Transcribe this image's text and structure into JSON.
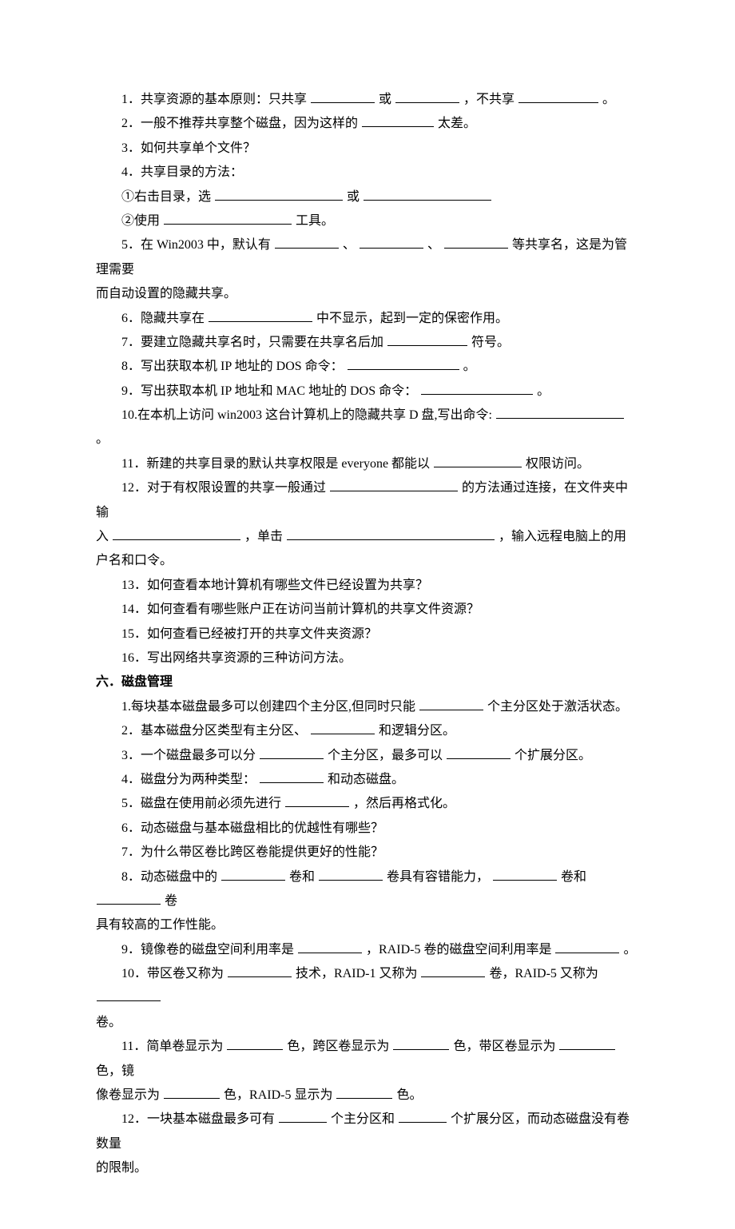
{
  "section5": {
    "q1": {
      "a": "1．共享资源的基本原则：只共享",
      "b": "或",
      "c": "，不共享",
      "d": "。"
    },
    "q2": {
      "a": "2．一般不推荐共享整个磁盘，因为这样的",
      "b": "太差。"
    },
    "q3": "3．如何共享单个文件？",
    "q4": "4．共享目录的方法：",
    "q4a": {
      "a": "①右击目录，选",
      "b": "或"
    },
    "q4b": {
      "a": "②使用",
      "b": "工具。"
    },
    "q5": {
      "a": "5．在 Win2003 中，默认有",
      "b": "、",
      "c": "、",
      "d": "等共享名，这是为管理需要"
    },
    "q5_cont": "而自动设置的隐藏共享。",
    "q6": {
      "a": "6．隐藏共享在",
      "b": "中不显示，起到一定的保密作用。"
    },
    "q7": {
      "a": "7．要建立隐藏共享名时，只需要在共享名后加",
      "b": "符号。"
    },
    "q8": {
      "a": "8．写出获取本机 IP 地址的 DOS 命令：",
      "b": "。"
    },
    "q9": {
      "a": "9．写出获取本机 IP 地址和 MAC 地址的 DOS 命令：",
      "b": "。"
    },
    "q10": {
      "a": "10.在本机上访问 win2003 这台计算机上的隐藏共享 D 盘,写出命令:",
      "b": "。"
    },
    "q11": {
      "a": "11．新建的共享目录的默认共享权限是 everyone 都能以",
      "b": "权限访问。"
    },
    "q12": {
      "a": "12．对于有权限设置的共享一般通过",
      "b": "的方法通过连接，在文件夹中输"
    },
    "q12_cont": {
      "a": "入",
      "b": "，单击",
      "c": "，输入远程电脑上的用"
    },
    "q12_cont2": "户名和口令。",
    "q13": "13．如何查看本地计算机有哪些文件已经设置为共享？",
    "q14": "14．如何查看有哪些账户正在访问当前计算机的共享文件资源？",
    "q15": "15．如何查看已经被打开的共享文件夹资源？",
    "q16": "16．写出网络共享资源的三种访问方法。"
  },
  "section6": {
    "heading": "六．磁盘管理",
    "q1": {
      "a": "1.每块基本磁盘最多可以创建四个主分区,但同时只能",
      "b": "个主分区处于激活状态。"
    },
    "q2": {
      "a": "2．基本磁盘分区类型有主分区、",
      "b": "和逻辑分区。"
    },
    "q3": {
      "a": "3．一个磁盘最多可以分",
      "b": "个主分区，最多可以",
      "c": "个扩展分区。"
    },
    "q4": {
      "a": "4．磁盘分为两种类型：",
      "b": "和动态磁盘。"
    },
    "q5": {
      "a": "5．磁盘在使用前必须先进行",
      "b": "，然后再格式化。"
    },
    "q6": "6．动态磁盘与基本磁盘相比的优越性有哪些？",
    "q7": "7．为什么带区卷比跨区卷能提供更好的性能？",
    "q8": {
      "a": "8．动态磁盘中的",
      "b": "卷和",
      "c": "卷具有容错能力，",
      "d": "卷和",
      "e": "卷"
    },
    "q8_cont": "具有较高的工作性能。",
    "q9": {
      "a": "9．镜像卷的磁盘空间利用率是",
      "b": "，RAID-5 卷的磁盘空间利用率是",
      "c": "。"
    },
    "q10": {
      "a": "10．带区卷又称为",
      "b": "技术，RAID-1 又称为",
      "c": "卷，RAID-5 又称为"
    },
    "q10_cont": "卷。",
    "q11": {
      "a": "11．简单卷显示为",
      "b": "色，跨区卷显示为",
      "c": "色，带区卷显示为",
      "d": "色，镜"
    },
    "q11_cont": {
      "a": "像卷显示为",
      "b": "色，RAID-5 显示为",
      "c": "色。"
    },
    "q12": {
      "a": "12．一块基本磁盘最多可有",
      "b": "个主分区和",
      "c": "个扩展分区，而动态磁盘没有卷数量"
    },
    "q12_cont": "的限制。"
  }
}
